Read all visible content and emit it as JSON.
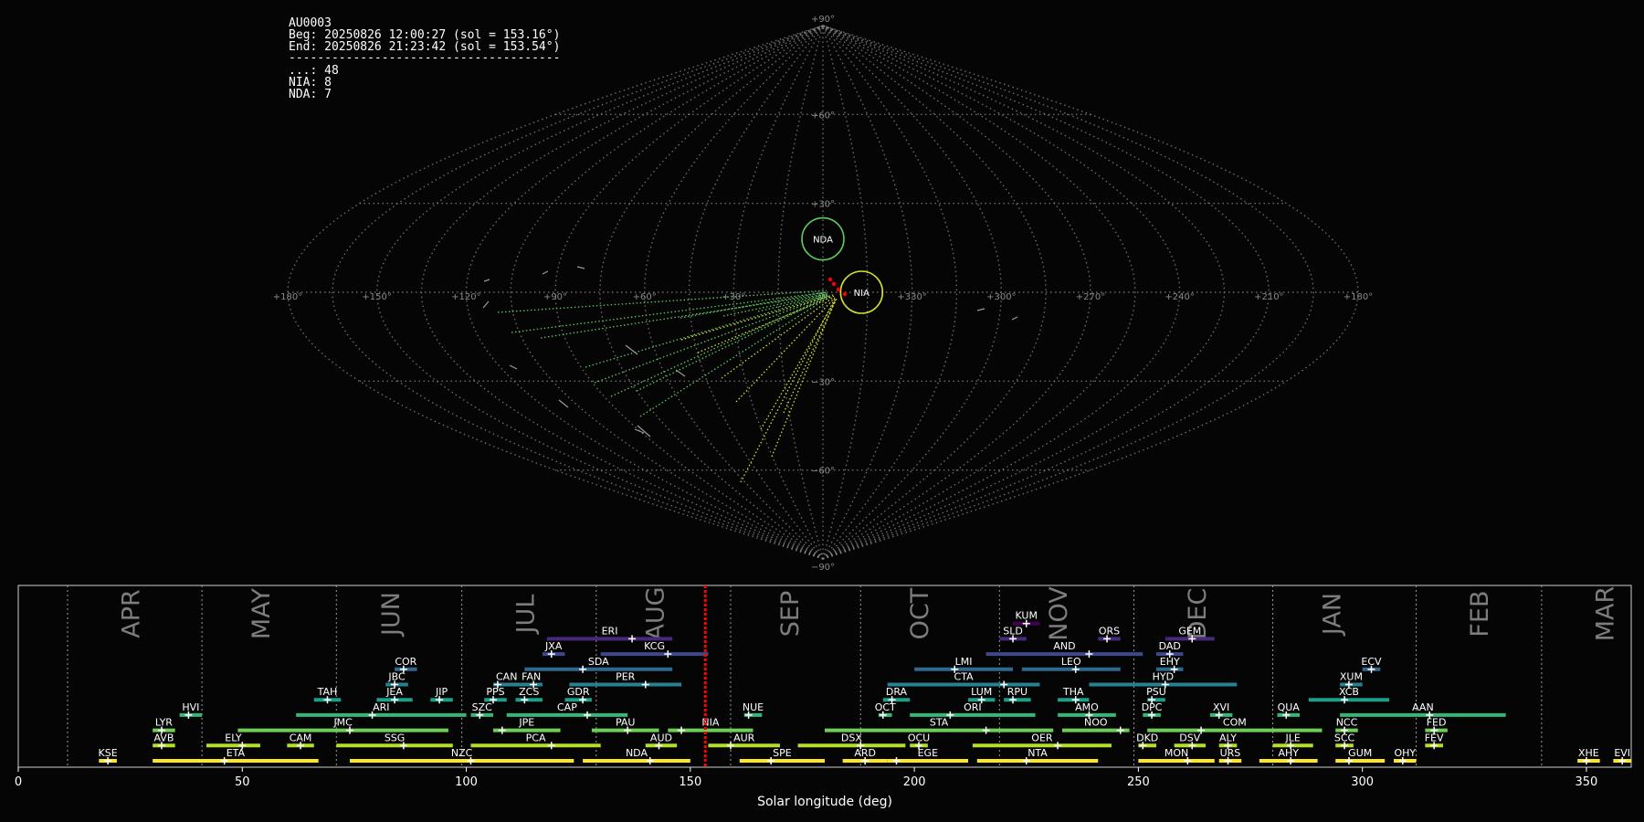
{
  "station": {
    "code": "AU0003",
    "beg": "Beg: 20250826 12:00:27 (sol = 153.16°)",
    "end": "End: 20250826 21:23:42 (sol = 153.54°)",
    "separator": "--------------------------------------",
    "counts": [
      "...: 48",
      "NIA: 8",
      "NDA: 7"
    ]
  },
  "colors": {
    "background": "#050505",
    "grid": "#8c8c8c",
    "current_sol": "#ff0000",
    "nda_circle": "#5ec962",
    "nia_circle": "#d6e030",
    "unassociated": "#9a9a9a"
  },
  "chart_data": [
    {
      "type": "scatter",
      "projection": "sinusoidal all-sky map (ecliptic, sun-centered)",
      "lon_ticks": [
        "+180°",
        "+150°",
        "+120°",
        "+90°",
        "+60°",
        "+30°",
        "0°",
        "+330°",
        "+300°",
        "+270°",
        "+240°",
        "+210°",
        "+180°"
      ],
      "lat_ticks": [
        "+90°",
        "+60°",
        "+30°",
        "0°",
        "−30°",
        "−60°",
        "−90°"
      ],
      "radiants": [
        {
          "code": "NDA",
          "lon": 0,
          "lat": 18,
          "radius_deg": 10,
          "color": "#5ec962"
        },
        {
          "code": "NIA",
          "lon": -13,
          "lat": 0,
          "radius_deg": 10,
          "color": "#d6e030"
        }
      ],
      "meteor_counts": {
        "unassociated": 48,
        "NIA": 8,
        "NDA": 7
      }
    },
    {
      "type": "bar",
      "subtype": "meteor shower activity periods (solar longitude)",
      "xlabel": "Solar longitude (deg)",
      "xlim": [
        0,
        360
      ],
      "xticks": [
        0,
        50,
        100,
        150,
        200,
        250,
        300,
        350
      ],
      "current_sol": 153.35,
      "months": [
        {
          "name": "APR",
          "start": 11,
          "mid": 25
        },
        {
          "name": "MAY",
          "start": 41,
          "mid": 54
        },
        {
          "name": "JUN",
          "start": 71,
          "mid": 83
        },
        {
          "name": "JUL",
          "start": 99,
          "mid": 113
        },
        {
          "name": "AUG",
          "start": 129,
          "mid": 142
        },
        {
          "name": "SEP",
          "start": 159,
          "mid": 172
        },
        {
          "name": "OCT",
          "start": 188,
          "mid": 201
        },
        {
          "name": "NOV",
          "start": 219,
          "mid": 232
        },
        {
          "name": "DEC",
          "start": 249,
          "mid": 263
        },
        {
          "name": "JAN",
          "start": 280,
          "mid": 293
        },
        {
          "name": "FEB",
          "start": 312,
          "mid": 326
        },
        {
          "name": "MAR",
          "start": 340,
          "mid": 354
        }
      ],
      "showers": [
        {
          "code": "KUM",
          "start": 222,
          "end": 228,
          "peak": 225,
          "row": 9
        },
        {
          "code": "ERI",
          "start": 118,
          "end": 146,
          "peak": 137,
          "row": 8
        },
        {
          "code": "SLD",
          "start": 219,
          "end": 225,
          "peak": 222,
          "row": 8
        },
        {
          "code": "ORS",
          "start": 241,
          "end": 246,
          "peak": 243,
          "row": 8
        },
        {
          "code": "GEM",
          "start": 256,
          "end": 267,
          "peak": 262,
          "row": 8
        },
        {
          "code": "JXA",
          "start": 117,
          "end": 122,
          "peak": 119,
          "row": 7
        },
        {
          "code": "KCG",
          "start": 130,
          "end": 154,
          "peak": 145,
          "row": 7
        },
        {
          "code": "AND",
          "start": 216,
          "end": 251,
          "peak": 239,
          "row": 7
        },
        {
          "code": "DAD",
          "start": 254,
          "end": 260,
          "peak": 257,
          "row": 7
        },
        {
          "code": "COR",
          "start": 84,
          "end": 89,
          "peak": 86,
          "row": 6
        },
        {
          "code": "SDA",
          "start": 113,
          "end": 146,
          "peak": 126,
          "row": 6
        },
        {
          "code": "LMI",
          "start": 200,
          "end": 222,
          "peak": 209,
          "row": 6
        },
        {
          "code": "LEO",
          "start": 224,
          "end": 246,
          "peak": 236,
          "row": 6
        },
        {
          "code": "EHY",
          "start": 254,
          "end": 260,
          "peak": 258,
          "row": 6
        },
        {
          "code": "ECV",
          "start": 300,
          "end": 304,
          "peak": 302,
          "row": 6
        },
        {
          "code": "JBC",
          "start": 82,
          "end": 87,
          "peak": 84,
          "row": 5
        },
        {
          "code": "CAN",
          "start": 106,
          "end": 112,
          "peak": 107,
          "row": 5
        },
        {
          "code": "FAN",
          "start": 112,
          "end": 117,
          "peak": 115,
          "row": 5
        },
        {
          "code": "PER",
          "start": 123,
          "end": 148,
          "peak": 140,
          "row": 5
        },
        {
          "code": "CTA",
          "start": 194,
          "end": 228,
          "peak": 220,
          "row": 5
        },
        {
          "code": "HYD",
          "start": 239,
          "end": 272,
          "peak": 256,
          "row": 5
        },
        {
          "code": "XUM",
          "start": 295,
          "end": 300,
          "peak": 297,
          "row": 5
        },
        {
          "code": "TAH",
          "start": 66,
          "end": 72,
          "peak": 69,
          "row": 4
        },
        {
          "code": "JEA",
          "start": 80,
          "end": 88,
          "peak": 84,
          "row": 4
        },
        {
          "code": "JIP",
          "start": 92,
          "end": 97,
          "peak": 94,
          "row": 4
        },
        {
          "code": "PPS",
          "start": 104,
          "end": 109,
          "peak": 106,
          "row": 4
        },
        {
          "code": "ZCS",
          "start": 111,
          "end": 117,
          "peak": 113,
          "row": 4
        },
        {
          "code": "GDR",
          "start": 122,
          "end": 128,
          "peak": 126,
          "row": 4
        },
        {
          "code": "DRA",
          "start": 193,
          "end": 199,
          "peak": 195,
          "row": 4
        },
        {
          "code": "LUM",
          "start": 212,
          "end": 218,
          "peak": 215,
          "row": 4
        },
        {
          "code": "RPU",
          "start": 220,
          "end": 226,
          "peak": 222,
          "row": 4
        },
        {
          "code": "THA",
          "start": 232,
          "end": 239,
          "peak": 236,
          "row": 4
        },
        {
          "code": "PSU",
          "start": 252,
          "end": 256,
          "peak": 253,
          "row": 4
        },
        {
          "code": "XCB",
          "start": 288,
          "end": 306,
          "peak": 296,
          "row": 4
        },
        {
          "code": "HVI",
          "start": 36,
          "end": 41,
          "peak": 38,
          "row": 3
        },
        {
          "code": "ARI",
          "start": 62,
          "end": 100,
          "peak": 79,
          "row": 3
        },
        {
          "code": "SZC",
          "start": 101,
          "end": 106,
          "peak": 103,
          "row": 3
        },
        {
          "code": "CAP",
          "start": 109,
          "end": 136,
          "peak": 127,
          "row": 3
        },
        {
          "code": "NUE",
          "start": 162,
          "end": 166,
          "peak": 163,
          "row": 3
        },
        {
          "code": "OCT",
          "start": 192,
          "end": 195,
          "peak": 193,
          "row": 3
        },
        {
          "code": "ORI",
          "start": 199,
          "end": 227,
          "peak": 208,
          "row": 3
        },
        {
          "code": "AMO",
          "start": 232,
          "end": 245,
          "peak": 239,
          "row": 3
        },
        {
          "code": "DPC",
          "start": 251,
          "end": 255,
          "peak": 253,
          "row": 3
        },
        {
          "code": "XVI",
          "start": 266,
          "end": 271,
          "peak": 268,
          "row": 3
        },
        {
          "code": "QUA",
          "start": 281,
          "end": 286,
          "peak": 283,
          "row": 3
        },
        {
          "code": "AAN",
          "start": 295,
          "end": 332,
          "peak": 315,
          "row": 3
        },
        {
          "code": "LYR",
          "start": 30,
          "end": 35,
          "peak": 32,
          "row": 2
        },
        {
          "code": "JMC",
          "start": 49,
          "end": 96,
          "peak": 74,
          "row": 2
        },
        {
          "code": "JPE",
          "start": 106,
          "end": 121,
          "peak": 108,
          "row": 2
        },
        {
          "code": "PAU",
          "start": 128,
          "end": 143,
          "peak": 136,
          "row": 2
        },
        {
          "code": "NIA",
          "start": 145,
          "end": 164,
          "peak": 148,
          "row": 2
        },
        {
          "code": "STA",
          "start": 180,
          "end": 231,
          "peak": 216,
          "row": 2
        },
        {
          "code": "NOO",
          "start": 233,
          "end": 248,
          "peak": 246,
          "row": 2
        },
        {
          "code": "COM",
          "start": 252,
          "end": 291,
          "peak": 264,
          "row": 2
        },
        {
          "code": "NCC",
          "start": 294,
          "end": 299,
          "peak": 296,
          "row": 2
        },
        {
          "code": "FED",
          "start": 314,
          "end": 319,
          "peak": 316,
          "row": 2
        },
        {
          "code": "AVB",
          "start": 30,
          "end": 35,
          "peak": 32,
          "row": 1
        },
        {
          "code": "ELY",
          "start": 42,
          "end": 54,
          "peak": 50,
          "row": 1
        },
        {
          "code": "CAM",
          "start": 60,
          "end": 66,
          "peak": 63,
          "row": 1
        },
        {
          "code": "SSG",
          "start": 71,
          "end": 97,
          "peak": 86,
          "row": 1
        },
        {
          "code": "PCA",
          "start": 101,
          "end": 130,
          "peak": 119,
          "row": 1
        },
        {
          "code": "AUD",
          "start": 140,
          "end": 147,
          "peak": 143,
          "row": 1
        },
        {
          "code": "AUR",
          "start": 154,
          "end": 170,
          "peak": 159,
          "row": 1
        },
        {
          "code": "DSX",
          "start": 174,
          "end": 198,
          "peak": 188,
          "row": 1
        },
        {
          "code": "OCU",
          "start": 199,
          "end": 203,
          "peak": 201,
          "row": 1
        },
        {
          "code": "OER",
          "start": 213,
          "end": 244,
          "peak": 232,
          "row": 1
        },
        {
          "code": "DKD",
          "start": 250,
          "end": 254,
          "peak": 251,
          "row": 1
        },
        {
          "code": "DSV",
          "start": 258,
          "end": 265,
          "peak": 262,
          "row": 1
        },
        {
          "code": "ALY",
          "start": 268,
          "end": 272,
          "peak": 270,
          "row": 1
        },
        {
          "code": "JLE",
          "start": 280,
          "end": 289,
          "peak": 284,
          "row": 1
        },
        {
          "code": "SCC",
          "start": 294,
          "end": 298,
          "peak": 296,
          "row": 1
        },
        {
          "code": "FEV",
          "start": 314,
          "end": 318,
          "peak": 316,
          "row": 1
        },
        {
          "code": "KSE",
          "start": 18,
          "end": 22,
          "peak": 20,
          "row": 0
        },
        {
          "code": "ETA",
          "start": 30,
          "end": 67,
          "peak": 46,
          "row": 0
        },
        {
          "code": "NZC",
          "start": 74,
          "end": 124,
          "peak": 101,
          "row": 0
        },
        {
          "code": "NDA",
          "start": 126,
          "end": 150,
          "peak": 141,
          "row": 0
        },
        {
          "code": "SPE",
          "start": 161,
          "end": 180,
          "peak": 168,
          "row": 0
        },
        {
          "code": "ARD",
          "start": 184,
          "end": 194,
          "peak": 189,
          "row": 0
        },
        {
          "code": "EGE",
          "start": 194,
          "end": 212,
          "peak": 196,
          "row": 0
        },
        {
          "code": "NTA",
          "start": 214,
          "end": 241,
          "peak": 225,
          "row": 0
        },
        {
          "code": "MON",
          "start": 250,
          "end": 267,
          "peak": 261,
          "row": 0
        },
        {
          "code": "URS",
          "start": 268,
          "end": 273,
          "peak": 270,
          "row": 0
        },
        {
          "code": "AHY",
          "start": 277,
          "end": 290,
          "peak": 284,
          "row": 0
        },
        {
          "code": "GUM",
          "start": 294,
          "end": 305,
          "peak": 297,
          "row": 0
        },
        {
          "code": "OHY",
          "start": 307,
          "end": 312,
          "peak": 309,
          "row": 0
        },
        {
          "code": "XHE",
          "start": 348,
          "end": 353,
          "peak": 350,
          "row": 0
        },
        {
          "code": "EVI",
          "start": 356,
          "end": 360,
          "peak": 358,
          "row": 0
        }
      ]
    }
  ]
}
